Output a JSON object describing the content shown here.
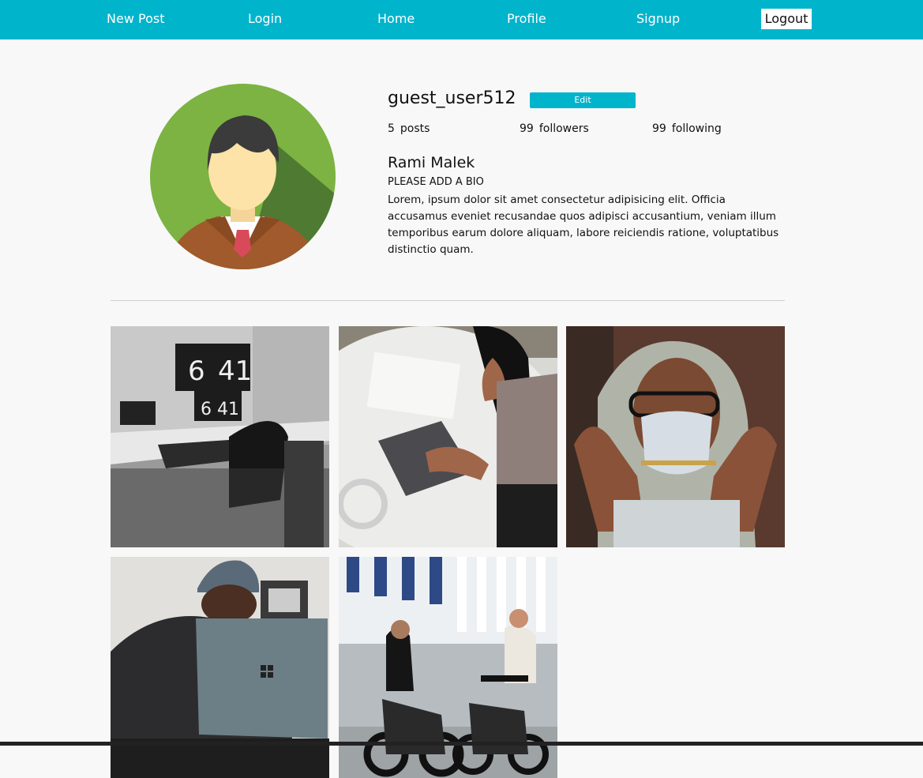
{
  "nav": {
    "items": [
      "New Post",
      "Login",
      "Home",
      "Profile",
      "Signup"
    ],
    "logout_label": "Logout"
  },
  "profile": {
    "avatar_icon": "person-avatar-icon",
    "username": "guest_user512",
    "edit_label": "Edit",
    "stats": [
      {
        "value": "5",
        "label": "posts"
      },
      {
        "value": "99",
        "label": "followers"
      },
      {
        "value": "99",
        "label": "following"
      }
    ],
    "full_name": "Rami Malek",
    "bio_heading": "PLEASE ADD A BIO",
    "bio_text": "Lorem, ipsum dolor sit amet consectetur adipisicing elit. Officia accusamus eveniet recusandae quos adipisci accusantium, veniam illum temporibus earum dolore aliquam, labore reiciendis ratione, voluptatibus distinctio quam."
  },
  "posts": [
    {
      "name": "post-desk-clock-photo"
    },
    {
      "name": "post-woman-laptop-photo"
    },
    {
      "name": "post-masked-man-photo"
    },
    {
      "name": "post-beanie-laptop-photo"
    },
    {
      "name": "post-scooter-men-photo"
    }
  ],
  "colors": {
    "accent": "#00b4cc",
    "background": "#f8f8f8"
  }
}
